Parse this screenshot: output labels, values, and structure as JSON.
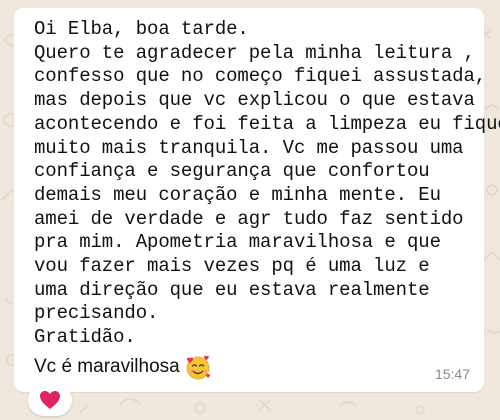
{
  "chat": {
    "message": {
      "lines": [
        "Oi Elba, boa tarde.",
        "Quero te agradecer pela minha leitura ,",
        "confesso que no começo fiquei assustada,",
        "mas depois que vc explicou o que estava",
        "acontecendo e foi feita a limpeza eu fiquei",
        "muito mais tranquila. Vc me passou uma",
        "confiança e segurança que confortou",
        "demais meu coração e minha mente. Eu",
        "amei de verdade e agr tudo faz sentido",
        "pra mim. Apometria maravilhosa e que",
        "vou fazer mais vezes pq é uma luz e",
        "uma direção que eu estava realmente",
        "precisando.",
        "Gratidão."
      ],
      "last_line_text": "Vc é maravilhosa",
      "last_line_emoji": "smiling-face-with-hearts-icon",
      "timestamp": "15:47"
    },
    "reaction": {
      "icon": "red-heart-icon",
      "color": "#e0245e"
    },
    "colors": {
      "wallpaper": "#efe7dc",
      "bubble": "#ffffff",
      "text": "#111111",
      "timestamp": "#8a8a8a"
    }
  }
}
